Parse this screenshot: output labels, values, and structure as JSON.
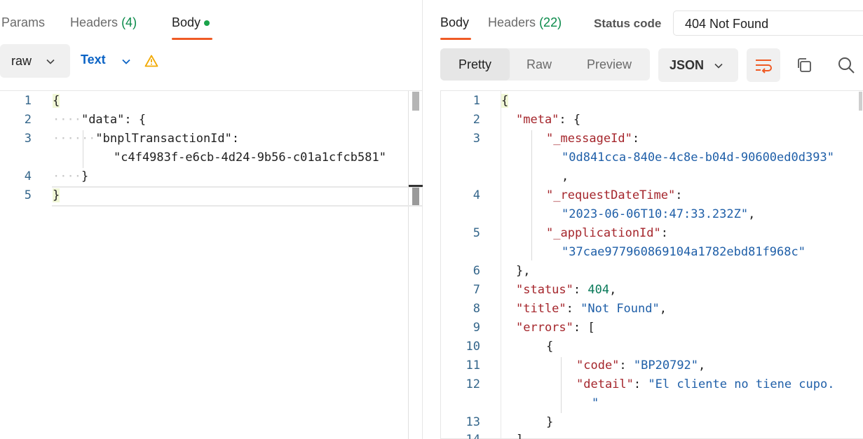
{
  "request": {
    "tabs": [
      {
        "label": "Params"
      },
      {
        "label": "Headers",
        "count": "(4)"
      },
      {
        "label": "Body"
      }
    ],
    "body_type": "raw",
    "format": "Text",
    "line_numbers": [
      "1",
      "2",
      "3",
      "4",
      "5"
    ],
    "code": {
      "open_brace": "{",
      "data_key": "\"data\"",
      "data_rest": ": {",
      "txn_key": "\"bnplTransactionId\"",
      "txn_colon": ":",
      "txn_value": "\"c4f4983f-e6cb-4d24-9b56-c01a1cfcb581\"",
      "close_inner": "}",
      "close_outer": "}"
    }
  },
  "response": {
    "tabs": [
      {
        "label": "Body"
      },
      {
        "label": "Headers",
        "count": "(22)"
      }
    ],
    "status_label": "Status code",
    "status_value": "404 Not Found",
    "view_modes": [
      "Pretty",
      "Raw",
      "Preview"
    ],
    "format": "JSON",
    "line_numbers": [
      "1",
      "2",
      "3",
      "",
      "4",
      "",
      "5",
      "",
      "6",
      "7",
      "8",
      "9",
      "10",
      "11",
      "12",
      "",
      "13",
      "14"
    ],
    "code": {
      "l1": "{",
      "meta_key": "\"meta\"",
      "meta_rest": ": {",
      "msg_key": "\"_messageId\"",
      "msg_colon": ":",
      "msg_value": "\"0d841cca-840e-4c8e-b04d-90600ed0d393\"",
      "msg_comma": ",",
      "req_key": "\"_requestDateTime\"",
      "req_colon": ":",
      "req_value": "\"2023-06-06T10:47:33.232Z\"",
      "req_comma": ",",
      "app_key": "\"_applicationId\"",
      "app_colon": ":",
      "app_value": "\"37cae977960869104a1782ebd81f968c\"",
      "close_meta": "},",
      "status_key": "\"status\"",
      "status_colon": ": ",
      "status_value": "404",
      "status_comma": ",",
      "title_key": "\"title\"",
      "title_colon": ": ",
      "title_value": "\"Not Found\"",
      "title_comma": ",",
      "errors_key": "\"errors\"",
      "errors_rest": ": [",
      "err_open": "{",
      "code_key": "\"code\"",
      "code_colon": ": ",
      "code_value": "\"BP20792\"",
      "code_comma": ",",
      "detail_key": "\"detail\"",
      "detail_colon": ": ",
      "detail_value": "\"El cliente no tiene cupo.",
      "detail_value_end": "\"",
      "err_close": "}",
      "l14": "]"
    }
  },
  "colors": {
    "accent": "#ef5b25",
    "count_green": "#0a8a4a",
    "link_blue": "#0b63c5",
    "warning": "#f2a900",
    "key_red": "#a5262c",
    "string_blue": "#1f5fa8"
  }
}
